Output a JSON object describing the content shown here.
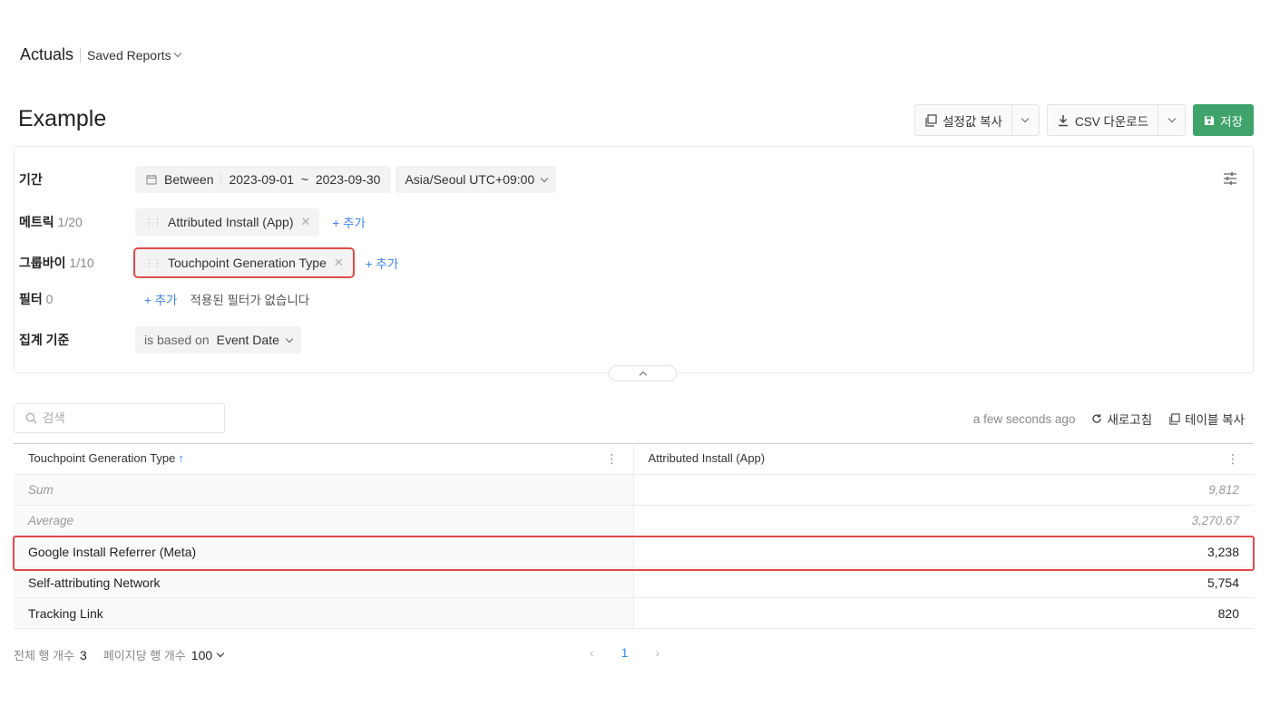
{
  "header": {
    "app_title": "Actuals",
    "saved_reports_label": "Saved Reports",
    "page_title": "Example"
  },
  "actions": {
    "copy_settings_label": "설정값 복사",
    "csv_download_label": "CSV 다운로드",
    "save_label": "저장",
    "save_color": "#3fa36b"
  },
  "filters": {
    "period": {
      "label": "기간",
      "mode": "Between",
      "range": "2023-09-01  ~  2023-09-30",
      "timezone": "Asia/Seoul UTC+09:00"
    },
    "metric": {
      "label": "메트릭",
      "count": "1/20",
      "chip": "Attributed Install (App)",
      "add_label": "+ 추가"
    },
    "groupby": {
      "label": "그룹바이",
      "count": "1/10",
      "chip": "Touchpoint Generation Type",
      "add_label": "+ 추가"
    },
    "filter": {
      "label": "필터",
      "count": "0",
      "add_label": "+ 추가",
      "empty_note": "적용된 필터가 없습니다"
    },
    "aggregation": {
      "label": "집계 기준",
      "prefix": "is based on",
      "value": "Event Date"
    }
  },
  "table_toolbar": {
    "search_placeholder": "검색",
    "timestamp": "a few seconds ago",
    "refresh_label": "새로고침",
    "copy_table_label": "테이블 복사"
  },
  "table": {
    "columns": [
      "Touchpoint Generation Type",
      "Attributed Install (App)"
    ],
    "aggregates": [
      {
        "label": "Sum",
        "value": "9,812"
      },
      {
        "label": "Average",
        "value": "3,270.67"
      }
    ],
    "rows": [
      {
        "name": "Google Install Referrer (Meta)",
        "value": "3,238"
      },
      {
        "name": "Self-attributing Network",
        "value": "5,754"
      },
      {
        "name": "Tracking Link",
        "value": "820"
      }
    ]
  },
  "footer": {
    "total_rows_label": "전체 행 개수",
    "total_rows": "3",
    "rows_per_page_label": "페이지당 행 개수",
    "rows_per_page": "100",
    "current_page": "1"
  },
  "colors": {
    "accent": "#3a85f3",
    "highlight": "#e04a4a"
  }
}
